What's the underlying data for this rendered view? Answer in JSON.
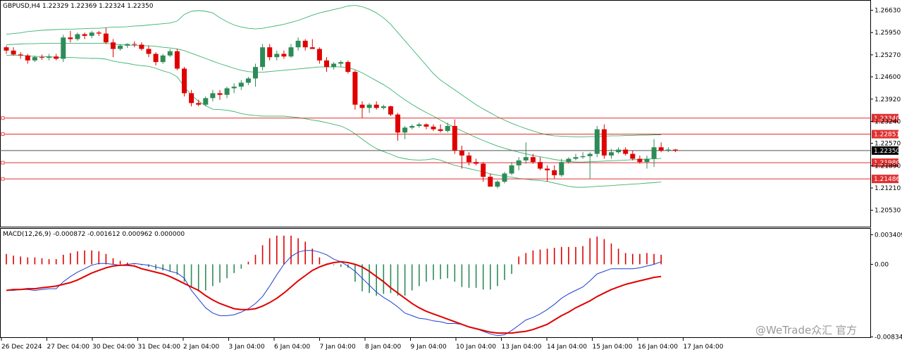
{
  "symbol_header": "GBPUSD,H4  1.22329 1.22369 1.22324 1.22350",
  "macd_header": "MACD(12,26,9) -0.000872 -0.001612 0.000962 0.000000",
  "watermark": "@WeTrade众汇 官方",
  "colors": {
    "bull": "#2e8b57",
    "bear": "#e00000",
    "bands": "#3cb371",
    "hline": "#e03030",
    "macd_line": "#1f3fcf",
    "signal_line": "#e00000"
  },
  "chart_data": [
    {
      "type": "candlestick",
      "title": "GBPUSD,H4  1.22329 1.22369 1.22324 1.22350",
      "ylim": [
        1.2005,
        1.269
      ],
      "y_ticks": [
        "1.26630",
        "1.25950",
        "1.25270",
        "1.24600",
        "1.23920",
        "1.23240",
        "1.22570",
        "1.21890",
        "1.21210",
        "1.20530"
      ],
      "x_ticks": [
        "26 Dec 2024",
        "27 Dec 04:00",
        "30 Dec 04:00",
        "31 Dec 04:00",
        "2 Jan 04:00",
        "3 Jan 04:00",
        "6 Jan 04:00",
        "7 Jan 04:00",
        "8 Jan 04:00",
        "9 Jan 04:00",
        "10 Jan 04:00",
        "13 Jan 04:00",
        "14 Jan 04:00",
        "15 Jan 04:00",
        "16 Jan 04:00",
        "17 Jan 04:00"
      ],
      "horizontal_levels": [
        {
          "label": "1.23340",
          "value": 1.2334
        },
        {
          "label": "1.22851",
          "value": 1.22851
        },
        {
          "label": "1.21980",
          "value": 1.2198
        },
        {
          "label": "1.21486",
          "value": 1.21486
        }
      ],
      "current_price": {
        "label": "1.22350",
        "value": 1.2235
      },
      "candles_ohlc": [
        [
          1.255,
          1.2555,
          1.253,
          1.254
        ],
        [
          1.254,
          1.255,
          1.2525,
          1.2528
        ],
        [
          1.2528,
          1.2535,
          1.2515,
          1.2525
        ],
        [
          1.2525,
          1.253,
          1.25,
          1.251
        ],
        [
          1.251,
          1.2525,
          1.2505,
          1.252
        ],
        [
          1.252,
          1.2528,
          1.2512,
          1.2518
        ],
        [
          1.2518,
          1.253,
          1.251,
          1.2522
        ],
        [
          1.2522,
          1.253,
          1.251,
          1.2515
        ],
        [
          1.2515,
          1.2588,
          1.2505,
          1.258
        ],
        [
          1.258,
          1.26,
          1.2565,
          1.2575
        ],
        [
          1.2575,
          1.2595,
          1.257,
          1.259
        ],
        [
          1.259,
          1.2595,
          1.2575,
          1.2585
        ],
        [
          1.2585,
          1.26,
          1.2578,
          1.2595
        ],
        [
          1.2595,
          1.26,
          1.2585,
          1.2592
        ],
        [
          1.2592,
          1.261,
          1.256,
          1.2565
        ],
        [
          1.2565,
          1.2575,
          1.252,
          1.2545
        ],
        [
          1.2545,
          1.256,
          1.254,
          1.2555
        ],
        [
          1.2555,
          1.2562,
          1.2548,
          1.256
        ],
        [
          1.256,
          1.2568,
          1.255,
          1.2558
        ],
        [
          1.2558,
          1.2565,
          1.254,
          1.2545
        ],
        [
          1.2545,
          1.2555,
          1.252,
          1.253
        ],
        [
          1.253,
          1.2535,
          1.2495,
          1.2505
        ],
        [
          1.2505,
          1.253,
          1.25,
          1.2525
        ],
        [
          1.2525,
          1.2545,
          1.252,
          1.2538
        ],
        [
          1.2538,
          1.2545,
          1.248,
          1.2485
        ],
        [
          1.2485,
          1.249,
          1.24,
          1.241
        ],
        [
          1.241,
          1.242,
          1.237,
          1.238
        ],
        [
          1.238,
          1.239,
          1.237,
          1.2375
        ],
        [
          1.2375,
          1.24,
          1.237,
          1.2395
        ],
        [
          1.2395,
          1.242,
          1.2385,
          1.241
        ],
        [
          1.241,
          1.242,
          1.239,
          1.2405
        ],
        [
          1.2405,
          1.243,
          1.2395,
          1.2425
        ],
        [
          1.2425,
          1.244,
          1.241,
          1.243
        ],
        [
          1.243,
          1.245,
          1.242,
          1.2442
        ],
        [
          1.2442,
          1.246,
          1.2435,
          1.2455
        ],
        [
          1.2455,
          1.25,
          1.243,
          1.249
        ],
        [
          1.249,
          1.256,
          1.248,
          1.255
        ],
        [
          1.255,
          1.256,
          1.251,
          1.252
        ],
        [
          1.252,
          1.254,
          1.251,
          1.253
        ],
        [
          1.253,
          1.254,
          1.2515,
          1.2522
        ],
        [
          1.2522,
          1.256,
          1.2518,
          1.255
        ],
        [
          1.255,
          1.258,
          1.254,
          1.257
        ],
        [
          1.257,
          1.2575,
          1.254,
          1.255
        ],
        [
          1.255,
          1.2575,
          1.2545,
          1.2545
        ],
        [
          1.2545,
          1.255,
          1.25,
          1.251
        ],
        [
          1.251,
          1.252,
          1.2475,
          1.249
        ],
        [
          1.249,
          1.2505,
          1.2482,
          1.25
        ],
        [
          1.25,
          1.251,
          1.249,
          1.2505
        ],
        [
          1.2505,
          1.251,
          1.247,
          1.2475
        ],
        [
          1.2475,
          1.248,
          1.236,
          1.2375
        ],
        [
          1.2375,
          1.2385,
          1.2335,
          1.2365
        ],
        [
          1.2365,
          1.238,
          1.235,
          1.2375
        ],
        [
          1.2375,
          1.2385,
          1.236,
          1.2365
        ],
        [
          1.2365,
          1.2375,
          1.236,
          1.237
        ],
        [
          1.237,
          1.2372,
          1.234,
          1.2345
        ],
        [
          1.2345,
          1.235,
          1.2265,
          1.229
        ],
        [
          1.229,
          1.231,
          1.227,
          1.2305
        ],
        [
          1.2305,
          1.2315,
          1.23,
          1.231
        ],
        [
          1.231,
          1.232,
          1.2305,
          1.2315
        ],
        [
          1.2315,
          1.2318,
          1.23,
          1.2308
        ],
        [
          1.2308,
          1.2315,
          1.2295,
          1.23
        ],
        [
          1.23,
          1.2315,
          1.229,
          1.2295
        ],
        [
          1.2295,
          1.232,
          1.229,
          1.231
        ],
        [
          1.231,
          1.233,
          1.2225,
          1.2235
        ],
        [
          1.2235,
          1.225,
          1.218,
          1.222
        ],
        [
          1.222,
          1.223,
          1.219,
          1.22
        ],
        [
          1.22,
          1.221,
          1.219,
          1.2195
        ],
        [
          1.2195,
          1.22,
          1.214,
          1.2155
        ],
        [
          1.2155,
          1.2165,
          1.2125,
          1.2125
        ],
        [
          1.2125,
          1.2145,
          1.212,
          1.214
        ],
        [
          1.214,
          1.217,
          1.2135,
          1.2165
        ],
        [
          1.2165,
          1.22,
          1.216,
          1.219
        ],
        [
          1.219,
          1.2215,
          1.2175,
          1.2205
        ],
        [
          1.2205,
          1.226,
          1.2195,
          1.2215
        ],
        [
          1.2215,
          1.2225,
          1.2195,
          1.22
        ],
        [
          1.22,
          1.2215,
          1.2175,
          1.218
        ],
        [
          1.218,
          1.219,
          1.214,
          1.2175
        ],
        [
          1.2175,
          1.219,
          1.215,
          1.216
        ],
        [
          1.216,
          1.221,
          1.2155,
          1.22
        ],
        [
          1.22,
          1.2215,
          1.2195,
          1.221
        ],
        [
          1.221,
          1.2225,
          1.2205,
          1.2215
        ],
        [
          1.2215,
          1.223,
          1.221,
          1.2218
        ],
        [
          1.2218,
          1.223,
          1.215,
          1.2225
        ],
        [
          1.2225,
          1.231,
          1.2215,
          1.23
        ],
        [
          1.23,
          1.2315,
          1.221,
          1.222
        ],
        [
          1.222,
          1.224,
          1.221,
          1.223
        ],
        [
          1.223,
          1.2245,
          1.2225,
          1.2238
        ],
        [
          1.2238,
          1.2245,
          1.222,
          1.2225
        ],
        [
          1.2225,
          1.2235,
          1.2205,
          1.221
        ],
        [
          1.221,
          1.222,
          1.2195,
          1.22
        ],
        [
          1.22,
          1.222,
          1.218,
          1.221
        ],
        [
          1.221,
          1.227,
          1.2185,
          1.2245
        ],
        [
          1.2245,
          1.226,
          1.223,
          1.2235
        ],
        [
          1.2235,
          1.2245,
          1.223,
          1.2238
        ],
        [
          1.2238,
          1.224,
          1.223,
          1.2235
        ]
      ],
      "bollinger_upper": [
        1.259,
        1.2592,
        1.2594,
        1.2598,
        1.26,
        1.2602,
        1.2603,
        1.2604,
        1.2605,
        1.2605,
        1.2606,
        1.2607,
        1.2608,
        1.2608,
        1.261,
        1.2612,
        1.2612,
        1.2613,
        1.2615,
        1.2616,
        1.2618,
        1.262,
        1.2622,
        1.2624,
        1.263,
        1.265,
        1.266,
        1.2662,
        1.266,
        1.2655,
        1.264,
        1.2628,
        1.2618,
        1.2612,
        1.2608,
        1.2606,
        1.2608,
        1.2612,
        1.2616,
        1.262,
        1.2626,
        1.2632,
        1.264,
        1.2648,
        1.2655,
        1.266,
        1.2665,
        1.267,
        1.2676,
        1.2678,
        1.2674,
        1.2666,
        1.2655,
        1.264,
        1.262,
        1.2595,
        1.257,
        1.2545,
        1.252,
        1.2495,
        1.247,
        1.245,
        1.2435,
        1.242,
        1.2405,
        1.239,
        1.2375,
        1.2362,
        1.235,
        1.2338,
        1.2328,
        1.2318,
        1.231,
        1.2302,
        1.2295,
        1.2288,
        1.2283,
        1.228,
        1.2279,
        1.2278,
        1.2277,
        1.2277,
        1.2278,
        1.2278,
        1.2279,
        1.228,
        1.228,
        1.2281,
        1.2281,
        1.2282,
        1.2282,
        1.2283,
        1.2283
      ],
      "bollinger_middle": [
        1.2558,
        1.2559,
        1.256,
        1.2561,
        1.2561,
        1.2562,
        1.2562,
        1.2562,
        1.2562,
        1.2562,
        1.2562,
        1.2562,
        1.2562,
        1.2562,
        1.2562,
        1.256,
        1.2558,
        1.2557,
        1.2556,
        1.2555,
        1.2555,
        1.2553,
        1.255,
        1.2548,
        1.2545,
        1.254,
        1.2532,
        1.2524,
        1.2516,
        1.2508,
        1.25,
        1.2493,
        1.2486,
        1.248,
        1.2476,
        1.2474,
        1.2474,
        1.2476,
        1.2478,
        1.248,
        1.2482,
        1.2484,
        1.2486,
        1.2488,
        1.249,
        1.249,
        1.249,
        1.249,
        1.2488,
        1.2482,
        1.2472,
        1.246,
        1.2448,
        1.2436,
        1.2422,
        1.2405,
        1.239,
        1.2376,
        1.2363,
        1.2351,
        1.234,
        1.2328,
        1.2316,
        1.2305,
        1.2295,
        1.2285,
        1.2275,
        1.2266,
        1.2257,
        1.2249,
        1.2242,
        1.2236,
        1.223,
        1.2225,
        1.222,
        1.2216,
        1.2212,
        1.2208,
        1.2205,
        1.2202,
        1.22,
        1.22,
        1.2201,
        1.2202,
        1.2203,
        1.2204,
        1.2205,
        1.2206,
        1.2207,
        1.2208,
        1.2209,
        1.221,
        1.2211
      ],
      "bollinger_lower": [
        1.2526,
        1.2526,
        1.2526,
        1.2524,
        1.2522,
        1.2522,
        1.2521,
        1.252,
        1.2519,
        1.2519,
        1.2518,
        1.2517,
        1.2516,
        1.2516,
        1.2514,
        1.2508,
        1.2504,
        1.2501,
        1.2497,
        1.2494,
        1.2492,
        1.2486,
        1.2478,
        1.2472,
        1.246,
        1.243,
        1.2404,
        1.2386,
        1.2372,
        1.2361,
        1.236,
        1.2358,
        1.2354,
        1.2348,
        1.2344,
        1.2342,
        1.234,
        1.234,
        1.234,
        1.234,
        1.2338,
        1.2336,
        1.2332,
        1.2328,
        1.2325,
        1.232,
        1.2315,
        1.231,
        1.23,
        1.2286,
        1.227,
        1.2254,
        1.2241,
        1.2232,
        1.2224,
        1.2215,
        1.221,
        1.2207,
        1.2206,
        1.2207,
        1.221,
        1.2206,
        1.2197,
        1.219,
        1.2185,
        1.218,
        1.2175,
        1.217,
        1.2164,
        1.216,
        1.2156,
        1.2154,
        1.215,
        1.2148,
        1.2145,
        1.2144,
        1.2141,
        1.2136,
        1.2131,
        1.2126,
        1.2123,
        1.2123,
        1.2124,
        1.2126,
        1.2127,
        1.2128,
        1.213,
        1.2131,
        1.2133,
        1.2134,
        1.2136,
        1.2137,
        1.2139
      ]
    },
    {
      "type": "macd",
      "title": "MACD(12,26,9) -0.000872 -0.001612 0.000962 0.000000",
      "ylim": [
        -0.00838,
        0.0036
      ],
      "y_ticks": [
        {
          "label": "0.003409",
          "value": 0.003409
        },
        {
          "label": "0.00",
          "value": 0.0
        },
        {
          "label": "-0.008348",
          "value": -0.008348
        }
      ],
      "histogram": [
        0.0012,
        0.001,
        0.0009,
        0.0008,
        0.0008,
        0.0007,
        0.0006,
        0.0006,
        0.0011,
        0.0013,
        0.0015,
        0.0016,
        0.0016,
        0.0015,
        0.0012,
        0.0007,
        0.0004,
        0.0002,
        0.0001,
        -0.0001,
        -0.0003,
        -0.0006,
        -0.0007,
        -0.0008,
        -0.0012,
        -0.002,
        -0.0027,
        -0.0031,
        -0.003,
        -0.0025,
        -0.0021,
        -0.0016,
        -0.001,
        -0.0005,
        0.0003,
        0.0011,
        0.0022,
        0.003,
        0.0033,
        0.0033,
        0.0033,
        0.003,
        0.0026,
        0.0018,
        0.0008,
        0.0001,
        -0.0001,
        -0.0003,
        -0.0004,
        -0.002,
        -0.0031,
        -0.0033,
        -0.0036,
        -0.0034,
        -0.0033,
        -0.0036,
        -0.0036,
        -0.003,
        -0.0025,
        -0.002,
        -0.0018,
        -0.0017,
        -0.0016,
        -0.002,
        -0.0026,
        -0.0027,
        -0.0027,
        -0.0029,
        -0.0029,
        -0.0025,
        -0.0018,
        -0.0011,
        0.0009,
        0.0013,
        0.0016,
        0.0017,
        0.0018,
        0.0019,
        0.002,
        0.002,
        0.002,
        0.0021,
        0.003,
        0.0032,
        0.0029,
        0.0024,
        0.0018,
        0.0013,
        0.0012,
        0.0012,
        0.0013,
        0.0012,
        0.0011
      ],
      "macd_line": [
        -0.003,
        -0.003,
        -0.0029,
        -0.0029,
        -0.003,
        -0.0029,
        -0.0028,
        -0.0028,
        -0.002,
        -0.0014,
        -0.0009,
        -0.0005,
        -0.0001,
        0.0001,
        0.0001,
        0.0,
        -0.0001,
        0.0,
        0.0001,
        0.0,
        -0.0001,
        -0.0003,
        -0.0005,
        -0.0008,
        -0.001,
        -0.0016,
        -0.003,
        -0.004,
        -0.005,
        -0.0056,
        -0.0059,
        -0.0059,
        -0.0058,
        -0.0055,
        -0.0051,
        -0.0045,
        -0.0037,
        -0.0025,
        -0.0012,
        0.0,
        0.0009,
        0.0014,
        0.0016,
        0.0016,
        0.0014,
        0.0011,
        0.0006,
        0.0003,
        -0.0002,
        -0.0008,
        -0.0016,
        -0.0024,
        -0.0032,
        -0.0038,
        -0.0043,
        -0.0049,
        -0.0056,
        -0.0059,
        -0.0062,
        -0.0063,
        -0.0065,
        -0.0066,
        -0.0068,
        -0.0068,
        -0.0069,
        -0.0072,
        -0.0074,
        -0.0077,
        -0.008,
        -0.0082,
        -0.0081,
        -0.0076,
        -0.007,
        -0.0064,
        -0.0061,
        -0.0057,
        -0.0052,
        -0.0046,
        -0.0039,
        -0.0034,
        -0.003,
        -0.0026,
        -0.0019,
        -0.0011,
        -0.0008,
        -0.0005,
        -0.0005,
        -0.0005,
        -0.0005,
        -0.0004,
        -0.0002,
        0.0,
        0.0003
      ],
      "signal_line": [
        -0.003,
        -0.0029,
        -0.0029,
        -0.0028,
        -0.0028,
        -0.0027,
        -0.0026,
        -0.0025,
        -0.0023,
        -0.0021,
        -0.0018,
        -0.0014,
        -0.001,
        -0.0007,
        -0.0004,
        -0.0002,
        -0.0001,
        -0.0001,
        -0.0002,
        -0.0005,
        -0.0007,
        -0.0009,
        -0.0011,
        -0.0014,
        -0.0018,
        -0.0022,
        -0.0026,
        -0.003,
        -0.0036,
        -0.0041,
        -0.0045,
        -0.0048,
        -0.0051,
        -0.0052,
        -0.0052,
        -0.0051,
        -0.0048,
        -0.0044,
        -0.0039,
        -0.0033,
        -0.0026,
        -0.0019,
        -0.0013,
        -0.0007,
        -0.0003,
        0.0,
        0.0002,
        0.0003,
        0.0002,
        0.0,
        -0.0003,
        -0.0008,
        -0.0014,
        -0.002,
        -0.0027,
        -0.0033,
        -0.0039,
        -0.0045,
        -0.005,
        -0.0054,
        -0.0057,
        -0.006,
        -0.0063,
        -0.0066,
        -0.0069,
        -0.0072,
        -0.0074,
        -0.0076,
        -0.0078,
        -0.0079,
        -0.0079,
        -0.0079,
        -0.0078,
        -0.0077,
        -0.0075,
        -0.0072,
        -0.0069,
        -0.0064,
        -0.0059,
        -0.0055,
        -0.005,
        -0.0046,
        -0.0042,
        -0.0037,
        -0.0033,
        -0.0029,
        -0.0026,
        -0.0023,
        -0.0021,
        -0.0019,
        -0.0017,
        -0.0015,
        -0.0014
      ]
    }
  ]
}
